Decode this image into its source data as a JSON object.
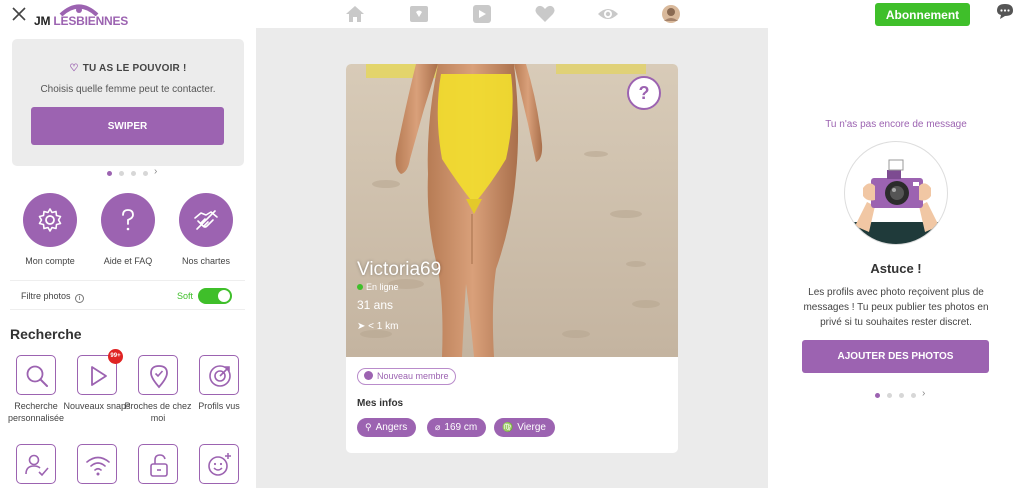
{
  "app": {
    "logo_prefix": "JM",
    "logo_brand": "LESBIENNES",
    "subscribe_label": "Abonnement"
  },
  "colors": {
    "accent": "#9c63b1",
    "green": "#3fbf2a",
    "badge_red": "#e02424"
  },
  "nav": {
    "icons": [
      "home-icon",
      "cards-icon",
      "play-icon",
      "heart-icon",
      "eye-icon",
      "avatar"
    ]
  },
  "promo": {
    "title": "TU AS LE POUVOIR !",
    "subtitle": "Choisis quelle femme peut te contacter.",
    "button_label": "SWIPER"
  },
  "quick_links": [
    {
      "label": "Mon compte",
      "icon": "gear-icon"
    },
    {
      "label": "Aide et FAQ",
      "icon": "question-icon"
    },
    {
      "label": "Nos chartes",
      "icon": "handshake-icon"
    }
  ],
  "filter": {
    "label": "Filtre photos",
    "value": "Soft"
  },
  "search": {
    "title": "Recherche",
    "tiles": [
      {
        "label": "Recherche personnalisée",
        "icon": "magnifier-icon"
      },
      {
        "label": "Nouveaux snaps",
        "icon": "play-icon",
        "badge": "99+"
      },
      {
        "label": "Proches de chez moi",
        "icon": "location-icon"
      },
      {
        "label": "Profils vus",
        "icon": "target-icon"
      },
      {
        "label": "",
        "icon": "user-check-icon"
      },
      {
        "label": "",
        "icon": "wifi-icon"
      },
      {
        "label": "",
        "icon": "lock-icon"
      },
      {
        "label": "",
        "icon": "smiley-plus-icon"
      }
    ]
  },
  "profile": {
    "name": "Victoria69",
    "status": "En ligne",
    "age": "31 ans",
    "distance": "< 1 km",
    "badge": "Nouveau membre",
    "infos_title": "Mes infos",
    "chips": [
      {
        "icon": "location-icon",
        "label": "Angers"
      },
      {
        "icon": "ruler-icon",
        "label": "169 cm"
      },
      {
        "icon": "virgo-icon",
        "label": "Vierge"
      }
    ]
  },
  "messages": {
    "empty_text": "Tu n'as pas encore de message",
    "tip_title": "Astuce !",
    "tip_text": "Les profils avec photo reçoivent plus de messages ! Tu peux publier tes photos en privé si tu souhaites rester discret.",
    "button_label": "AJOUTER DES PHOTOS"
  }
}
